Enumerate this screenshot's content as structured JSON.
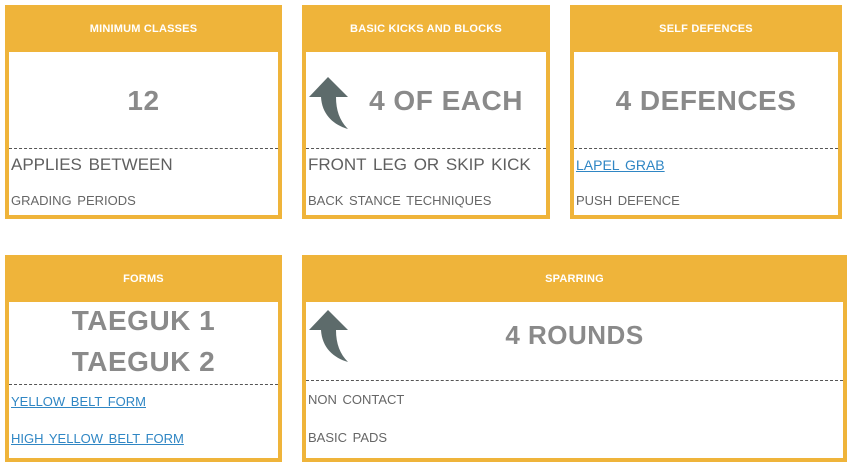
{
  "cards": [
    {
      "title": "MINIMUM CLASSES",
      "value": "12",
      "lines": [
        "APPLIES BETWEEN",
        "GRADING PERIODS"
      ]
    },
    {
      "title": "BASIC KICKS AND BLOCKS",
      "value": "4 OF EACH",
      "lines": [
        "FRONT LEG OR SKIP KICK",
        "BACK STANCE TECHNIQUES"
      ]
    },
    {
      "title": "SELF DEFENCES",
      "value": "4 DEFENCES",
      "lines": [
        "LAPEL GRAB",
        "PUSH DEFENCE"
      ]
    },
    {
      "title": "FORMS",
      "value_lines": [
        "TAEGUK 1",
        "TAEGUK 2"
      ],
      "lines": [
        "YELLOW BELT FORM",
        "HIGH YELLOW BELT FORM"
      ]
    },
    {
      "title": "SPARRING",
      "value": "4 ROUNDS",
      "lines": [
        "NON CONTACT",
        "BASIC PADS"
      ]
    }
  ],
  "colors": {
    "accent": "#efb43a",
    "value_text": "#8a8a8a",
    "link": "#2f86c4"
  },
  "icons": {
    "arrow": "curved-up-arrow-icon"
  }
}
